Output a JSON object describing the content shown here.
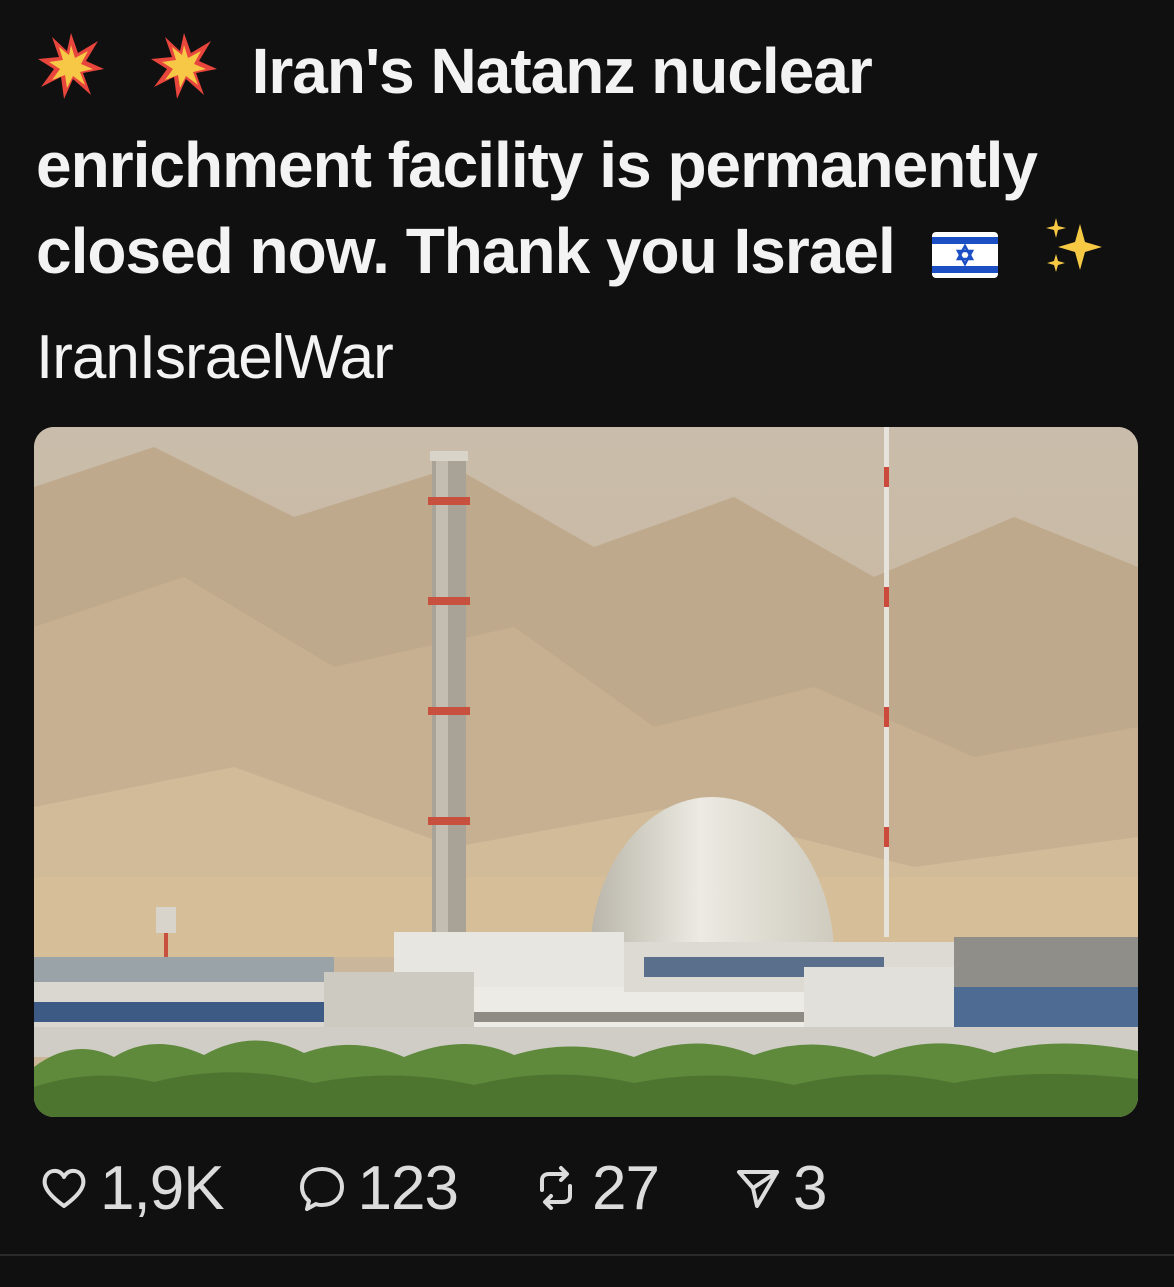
{
  "post": {
    "text_line1": "Iran's Natanz nuclear",
    "text_line2": "enrichment facility is permanently",
    "text_line3": "closed now. Thank you Israel",
    "hashtag": "IranIsraelWar",
    "image_alt": "Nuclear facility with tall chimney and white domed reactor in front of mountains"
  },
  "icons": {
    "lead_emoji_1": "collision-emoji-icon",
    "lead_emoji_2": "collision-emoji-icon",
    "flag": "israel-flag-icon",
    "trail_emoji": "sparkles-emoji-icon"
  },
  "actions": {
    "likes": "1,9K",
    "replies": "123",
    "reposts": "27",
    "shares": "3"
  },
  "colors": {
    "background": "#101010",
    "text": "#f3f3f3",
    "action_text": "#dcdcdc"
  }
}
